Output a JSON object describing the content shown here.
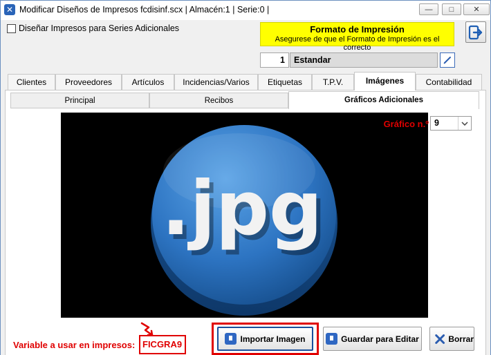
{
  "window": {
    "title": "Modificar Diseños de Impresos fcdisinf.scx   | Almacén:1 | Serie:0 |",
    "minimize_glyph": "—",
    "maximize_glyph": "□",
    "close_glyph": "✕"
  },
  "options": {
    "series_checkbox_label": "Diseñar Impresos para Series Adicionales",
    "series_checked": false
  },
  "format": {
    "title": "Formato de Impresión",
    "subtitle": "Asegurese de que el Formato de Impresión es el correcto",
    "number": "1",
    "name": "Estandar",
    "highlight_color": "#ffff00"
  },
  "tabs": [
    {
      "label": "Clientes"
    },
    {
      "label": "Proveedores"
    },
    {
      "label": "Artículos"
    },
    {
      "label": "Incidencias/Varios"
    },
    {
      "label": "Etiquetas"
    },
    {
      "label": "T.P.V."
    },
    {
      "label": "Imágenes",
      "active": true
    },
    {
      "label": "Contabilidad"
    }
  ],
  "subtabs": [
    {
      "label": "Principal"
    },
    {
      "label": "Recibos"
    },
    {
      "label": "Gráficos Adicionales",
      "active": true
    }
  ],
  "graphic": {
    "label": "Gráfico n.º",
    "selected": "9",
    "image_text": ".jpg"
  },
  "variable": {
    "label": "Variable a usar en impresos:",
    "value": "FICGRA9",
    "highlight_color": "#e00000"
  },
  "buttons": {
    "import": "Importar Imagen",
    "save_edit": "Guardar para Editar",
    "delete": "Borrar"
  }
}
